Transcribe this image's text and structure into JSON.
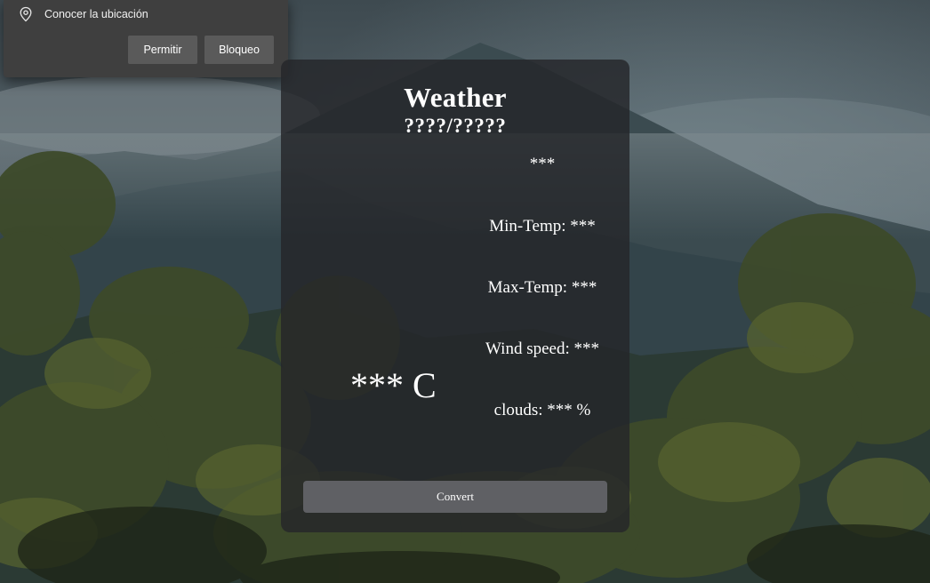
{
  "permission_prompt": {
    "message": "Conocer la ubicación",
    "allow_label": "Permitir",
    "block_label": "Bloqueo",
    "icon": "location-pin-icon"
  },
  "weather": {
    "title": "Weather",
    "location": "????/?????",
    "description": "***",
    "temperature": "*** C",
    "min_temp": "Min-Temp: ***",
    "max_temp": "Max-Temp: ***",
    "wind_speed": "Wind speed: ***",
    "clouds": "clouds: *** %",
    "convert_label": "Convert"
  },
  "colors": {
    "card_background": "#24262a",
    "button_background": "#5f6064",
    "popup_background": "#3f3f3f"
  }
}
